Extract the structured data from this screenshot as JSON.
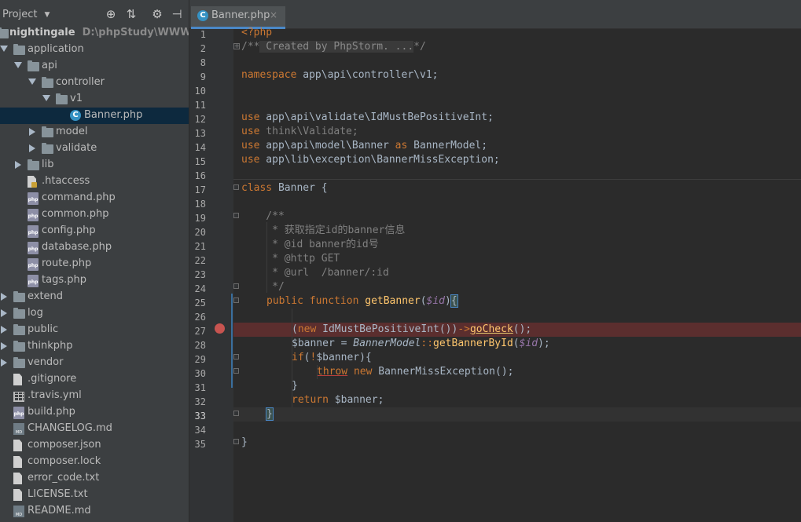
{
  "project_panel": {
    "title": "Project",
    "tree": [
      {
        "label": "nightingale",
        "path": "D:\\phpStudy\\WWW\\nighti",
        "type": "folder",
        "depth": 0,
        "expanded": true
      },
      {
        "label": "application",
        "type": "folder",
        "depth": 1,
        "expanded": true
      },
      {
        "label": "api",
        "type": "folder",
        "depth": 2,
        "expanded": true
      },
      {
        "label": "controller",
        "type": "folder",
        "depth": 3,
        "expanded": true
      },
      {
        "label": "v1",
        "type": "folder",
        "depth": 4,
        "expanded": true
      },
      {
        "label": "Banner.php",
        "type": "class",
        "depth": 5,
        "selected": true
      },
      {
        "label": "model",
        "type": "folder",
        "depth": 3,
        "expanded": false
      },
      {
        "label": "validate",
        "type": "folder",
        "depth": 3,
        "expanded": false
      },
      {
        "label": "lib",
        "type": "folder",
        "depth": 2,
        "expanded": false
      },
      {
        "label": ".htaccess",
        "type": "htaccess",
        "depth": 2
      },
      {
        "label": "command.php",
        "type": "php",
        "depth": 2
      },
      {
        "label": "common.php",
        "type": "php",
        "depth": 2
      },
      {
        "label": "config.php",
        "type": "php",
        "depth": 2
      },
      {
        "label": "database.php",
        "type": "php",
        "depth": 2
      },
      {
        "label": "route.php",
        "type": "php",
        "depth": 2
      },
      {
        "label": "tags.php",
        "type": "php",
        "depth": 2
      },
      {
        "label": "extend",
        "type": "folder",
        "depth": 1,
        "expanded": false
      },
      {
        "label": "log",
        "type": "folder",
        "depth": 1,
        "expanded": false
      },
      {
        "label": "public",
        "type": "folder",
        "depth": 1,
        "expanded": false
      },
      {
        "label": "thinkphp",
        "type": "folder",
        "depth": 1,
        "expanded": false
      },
      {
        "label": "vendor",
        "type": "folder",
        "depth": 1,
        "expanded": false
      },
      {
        "label": ".gitignore",
        "type": "txt",
        "depth": 1
      },
      {
        "label": ".travis.yml",
        "type": "table",
        "depth": 1
      },
      {
        "label": "build.php",
        "type": "php",
        "depth": 1
      },
      {
        "label": "CHANGELOG.md",
        "type": "md",
        "depth": 1
      },
      {
        "label": "composer.json",
        "type": "txt",
        "depth": 1
      },
      {
        "label": "composer.lock",
        "type": "txt",
        "depth": 1
      },
      {
        "label": "error_code.txt",
        "type": "txt",
        "depth": 1
      },
      {
        "label": "LICENSE.txt",
        "type": "txt",
        "depth": 1
      },
      {
        "label": "README.md",
        "type": "md",
        "depth": 1
      }
    ]
  },
  "editor": {
    "tab": {
      "label": "Banner.php",
      "close": "×"
    },
    "line_numbers": [
      "1",
      "2",
      "8",
      "9",
      "10",
      "11",
      "12",
      "13",
      "14",
      "15",
      "16",
      "17",
      "18",
      "19",
      "20",
      "21",
      "22",
      "23",
      "24",
      "25",
      "26",
      "27",
      "28",
      "29",
      "30",
      "31",
      "32",
      "33",
      "34",
      "35"
    ],
    "breakpoint_line": "27",
    "current_line": "33",
    "code": {
      "l1": "<?php",
      "l2_open": "/**",
      "l2_fold": " Created by PhpStorm. ...",
      "l2_close": "*/",
      "l9_kw": "namespace",
      "l9_rest": " app\\api\\controller\\v1;",
      "l12_kw": "use",
      "l12_rest": " app\\api\\validate\\IdMustBePositiveInt;",
      "l13_kw": "use",
      "l13_rest": " think\\Validate;",
      "l14_kw": "use",
      "l14_a": " app\\api\\model\\Banner ",
      "l14_as": "as",
      "l14_b": " BannerModel;",
      "l15_kw": "use",
      "l15_rest": " app\\lib\\exception\\BannerMissException;",
      "l17_kw": "class",
      "l17_rest": " Banner {",
      "l19": "    /**",
      "l20": "     * 获取指定id的banner信息",
      "l21": "     * @id banner的id号",
      "l22": "     * @http GET",
      "l23": "     * @url  /banner/:id",
      "l24": "     */",
      "l25_pub": "public",
      "l25_fn": "function",
      "l25_name": "getBanner",
      "l25_open": "(",
      "l25_var": "$id",
      "l25_close": ")",
      "l25_brace": "{",
      "l27_open": "(",
      "l27_new": "new",
      "l27_cls": " IdMustBePositiveInt())",
      "l27_arrow": "->",
      "l27_m": "goCheck",
      "l27_end": "();",
      "l28_a": "$banner = ",
      "l28_cls": "BannerModel",
      "l28_sep": "::",
      "l28_m": "getBannerById",
      "l28_open": "(",
      "l28_var": "$id",
      "l28_end": ");",
      "l29_if": "if",
      "l29_open": "(",
      "l29_not": "!",
      "l29_rest": "$banner){",
      "l30_throw": "throw",
      "l30_new": "new",
      "l30_rest": " BannerMissException();",
      "l31": "}",
      "l32_ret": "return",
      "l32_rest": " $banner;",
      "l33": "}",
      "l35": "}"
    }
  },
  "colors": {
    "keyword": "#cc7832",
    "function": "#ffc66d",
    "variable": "#9876aa",
    "comment": "#808080",
    "breakpoint": "#c75450",
    "selection": "#0d293e"
  }
}
